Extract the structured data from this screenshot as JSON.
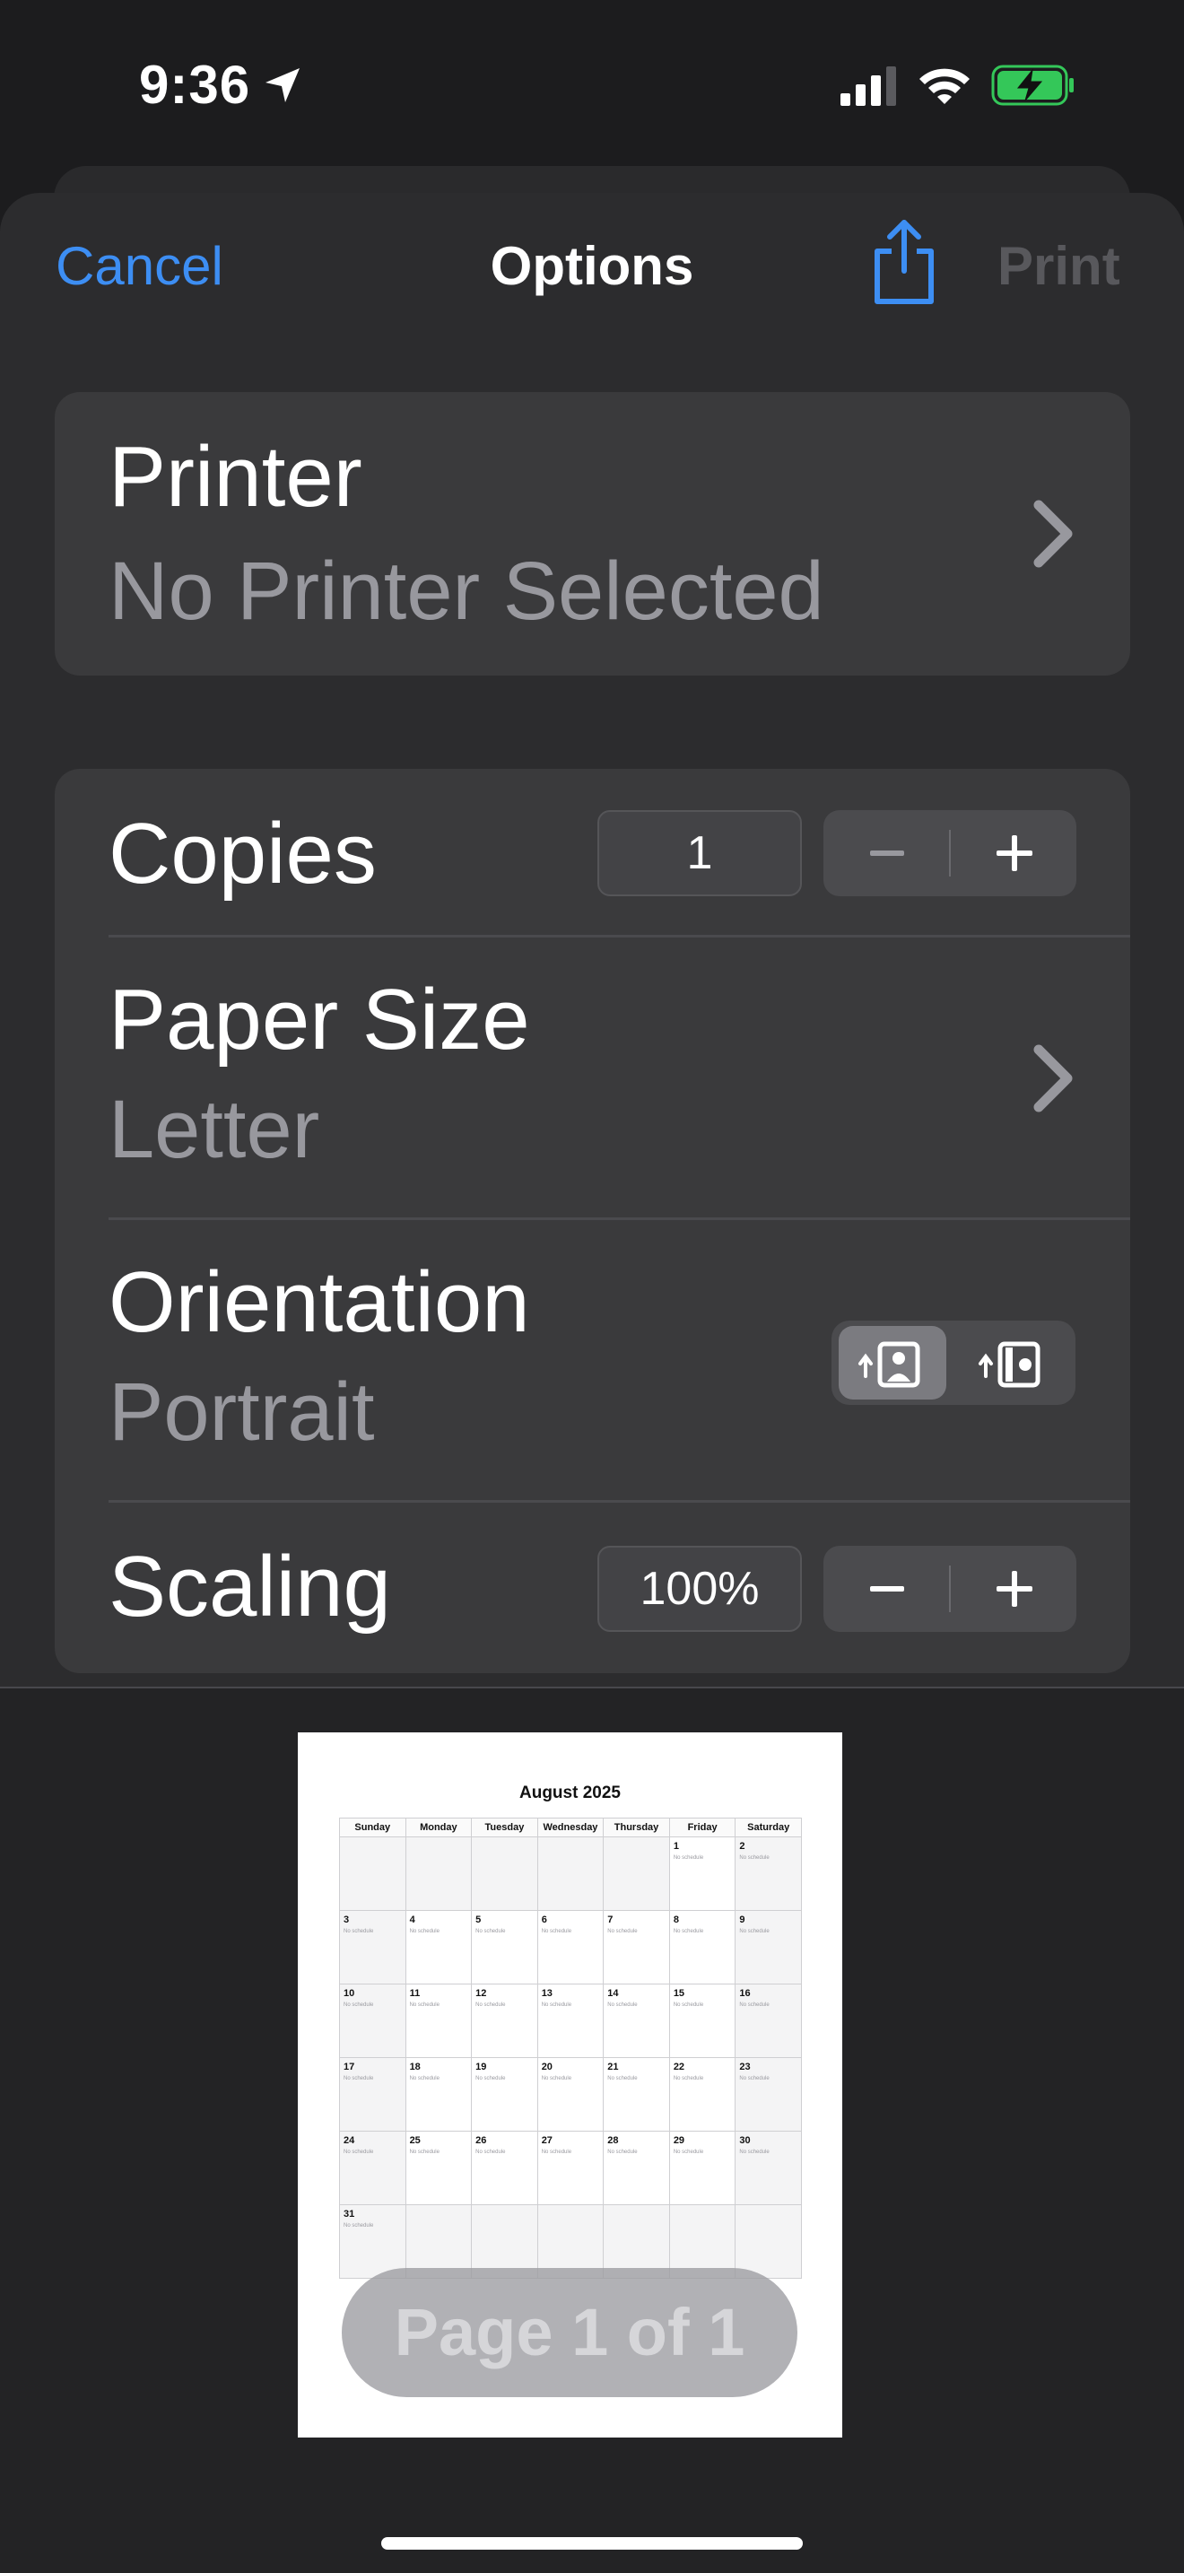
{
  "status_bar": {
    "time": "9:36"
  },
  "nav": {
    "cancel_label": "Cancel",
    "title": "Options",
    "print_label": "Print"
  },
  "printer": {
    "title": "Printer",
    "value": "No Printer Selected"
  },
  "copies": {
    "label": "Copies",
    "value": "1"
  },
  "paper_size": {
    "label": "Paper Size",
    "value": "Letter"
  },
  "orientation": {
    "label": "Orientation",
    "value": "Portrait"
  },
  "scaling": {
    "label": "Scaling",
    "value": "100%"
  },
  "preview": {
    "calendar_title": "August 2025",
    "weekdays": [
      "Sunday",
      "Monday",
      "Tuesday",
      "Wednesday",
      "Thursday",
      "Friday",
      "Saturday"
    ],
    "weeks": [
      [
        "",
        "",
        "",
        "",
        "",
        "1",
        "2"
      ],
      [
        "3",
        "4",
        "5",
        "6",
        "7",
        "8",
        "9"
      ],
      [
        "10",
        "11",
        "12",
        "13",
        "14",
        "15",
        "16"
      ],
      [
        "17",
        "18",
        "19",
        "20",
        "21",
        "22",
        "23"
      ],
      [
        "24",
        "25",
        "26",
        "27",
        "28",
        "29",
        "30"
      ],
      [
        "31",
        "",
        "",
        "",
        "",
        "",
        ""
      ]
    ],
    "cell_subtext": "No schedule",
    "page_indicator": "Page 1 of 1"
  },
  "colors": {
    "accent": "#3d8ef3",
    "battery": "#34c759"
  }
}
